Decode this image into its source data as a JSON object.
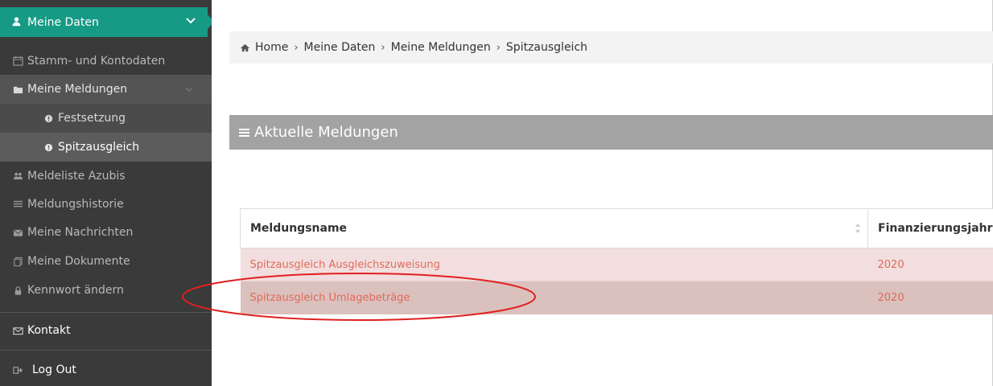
{
  "sidebar": {
    "top_item": {
      "label": "Meine Daten",
      "icon": "user-icon"
    },
    "items": [
      {
        "label": "Stamm- und Kontodaten",
        "icon": "calendar-icon"
      },
      {
        "label": "Meine Meldungen",
        "icon": "folder-icon"
      },
      {
        "label": "Festsetzung",
        "icon": "info-circle-icon"
      },
      {
        "label": "Spitzausgleich",
        "icon": "info-circle-icon"
      },
      {
        "label": "Meldeliste Azubis",
        "icon": "users-icon"
      },
      {
        "label": "Meldungshistorie",
        "icon": "list-icon"
      },
      {
        "label": "Meine Nachrichten",
        "icon": "envelope-icon"
      },
      {
        "label": "Meine Dokumente",
        "icon": "documents-icon"
      },
      {
        "label": "Kennwort ändern",
        "icon": "lock-icon"
      },
      {
        "label": "Kontakt",
        "icon": "envelope-outline-icon"
      },
      {
        "label": "Log Out",
        "icon": "sign-out-icon"
      }
    ]
  },
  "breadcrumb": {
    "home": "Home",
    "items": [
      "Meine Daten",
      "Meine Meldungen",
      "Spitzausgleich"
    ],
    "separator": "›"
  },
  "panel": {
    "title": "Aktuelle Meldungen"
  },
  "table": {
    "headers": [
      "Meldungsname",
      "Finanzierungsjahr"
    ],
    "rows": [
      {
        "name": "Spitzausgleich Ausgleichszuweisung",
        "year": "2020"
      },
      {
        "name": "Spitzausgleich Umlagebeträge",
        "year": "2020"
      }
    ]
  },
  "colors": {
    "accent": "#169a86",
    "sidebar_bg": "#3a3a3a",
    "panel_header": "#a3a3a3",
    "row_link": "#e06a5c",
    "annotation": "#e02020"
  }
}
